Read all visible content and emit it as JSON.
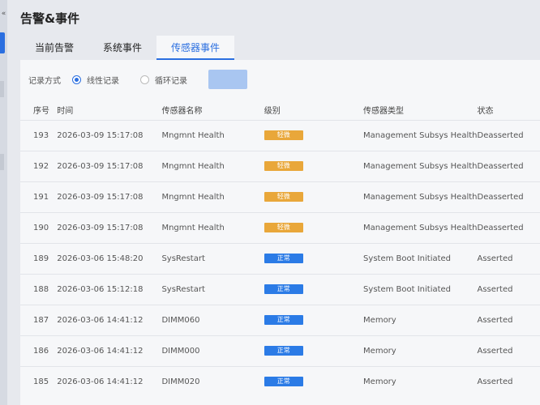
{
  "page": {
    "title": "告警&事件"
  },
  "tabs": [
    {
      "label": "当前告警",
      "active": false
    },
    {
      "label": "系统事件",
      "active": false
    },
    {
      "label": "传感器事件",
      "active": true
    }
  ],
  "record_mode": {
    "label": "记录方式",
    "options": [
      {
        "label": "线性记录",
        "checked": true
      },
      {
        "label": "循环记录",
        "checked": false
      }
    ],
    "save_label": ""
  },
  "table": {
    "headers": {
      "id": "序号",
      "time": "时间",
      "name": "传感器名称",
      "level": "级别",
      "type": "传感器类型",
      "state": "状态"
    },
    "rows": [
      {
        "id": "193",
        "time": "2026-03-09 15:17:08",
        "name": "Mngmnt Health",
        "level": "轻微",
        "level_kind": "warn",
        "type": "Management Subsys Health",
        "state": "Deasserted"
      },
      {
        "id": "192",
        "time": "2026-03-09 15:17:08",
        "name": "Mngmnt Health",
        "level": "轻微",
        "level_kind": "warn",
        "type": "Management Subsys Health",
        "state": "Deasserted"
      },
      {
        "id": "191",
        "time": "2026-03-09 15:17:08",
        "name": "Mngmnt Health",
        "level": "轻微",
        "level_kind": "warn",
        "type": "Management Subsys Health",
        "state": "Deasserted"
      },
      {
        "id": "190",
        "time": "2026-03-09 15:17:08",
        "name": "Mngmnt Health",
        "level": "轻微",
        "level_kind": "warn",
        "type": "Management Subsys Health",
        "state": "Deasserted"
      },
      {
        "id": "189",
        "time": "2026-03-06 15:48:20",
        "name": "SysRestart",
        "level": "正常",
        "level_kind": "ok",
        "type": "System Boot Initiated",
        "state": "Asserted"
      },
      {
        "id": "188",
        "time": "2026-03-06 15:12:18",
        "name": "SysRestart",
        "level": "正常",
        "level_kind": "ok",
        "type": "System Boot Initiated",
        "state": "Asserted"
      },
      {
        "id": "187",
        "time": "2026-03-06 14:41:12",
        "name": "DIMM060",
        "level": "正常",
        "level_kind": "ok",
        "type": "Memory",
        "state": "Asserted"
      },
      {
        "id": "186",
        "time": "2026-03-06 14:41:12",
        "name": "DIMM000",
        "level": "正常",
        "level_kind": "ok",
        "type": "Memory",
        "state": "Asserted"
      },
      {
        "id": "185",
        "time": "2026-03-06 14:41:12",
        "name": "DIMM020",
        "level": "正常",
        "level_kind": "ok",
        "type": "Memory",
        "state": "Asserted"
      }
    ]
  },
  "colors": {
    "accent": "#2b6fe0",
    "warn_badge": "#e9a73a",
    "ok_badge": "#2b7be6"
  }
}
